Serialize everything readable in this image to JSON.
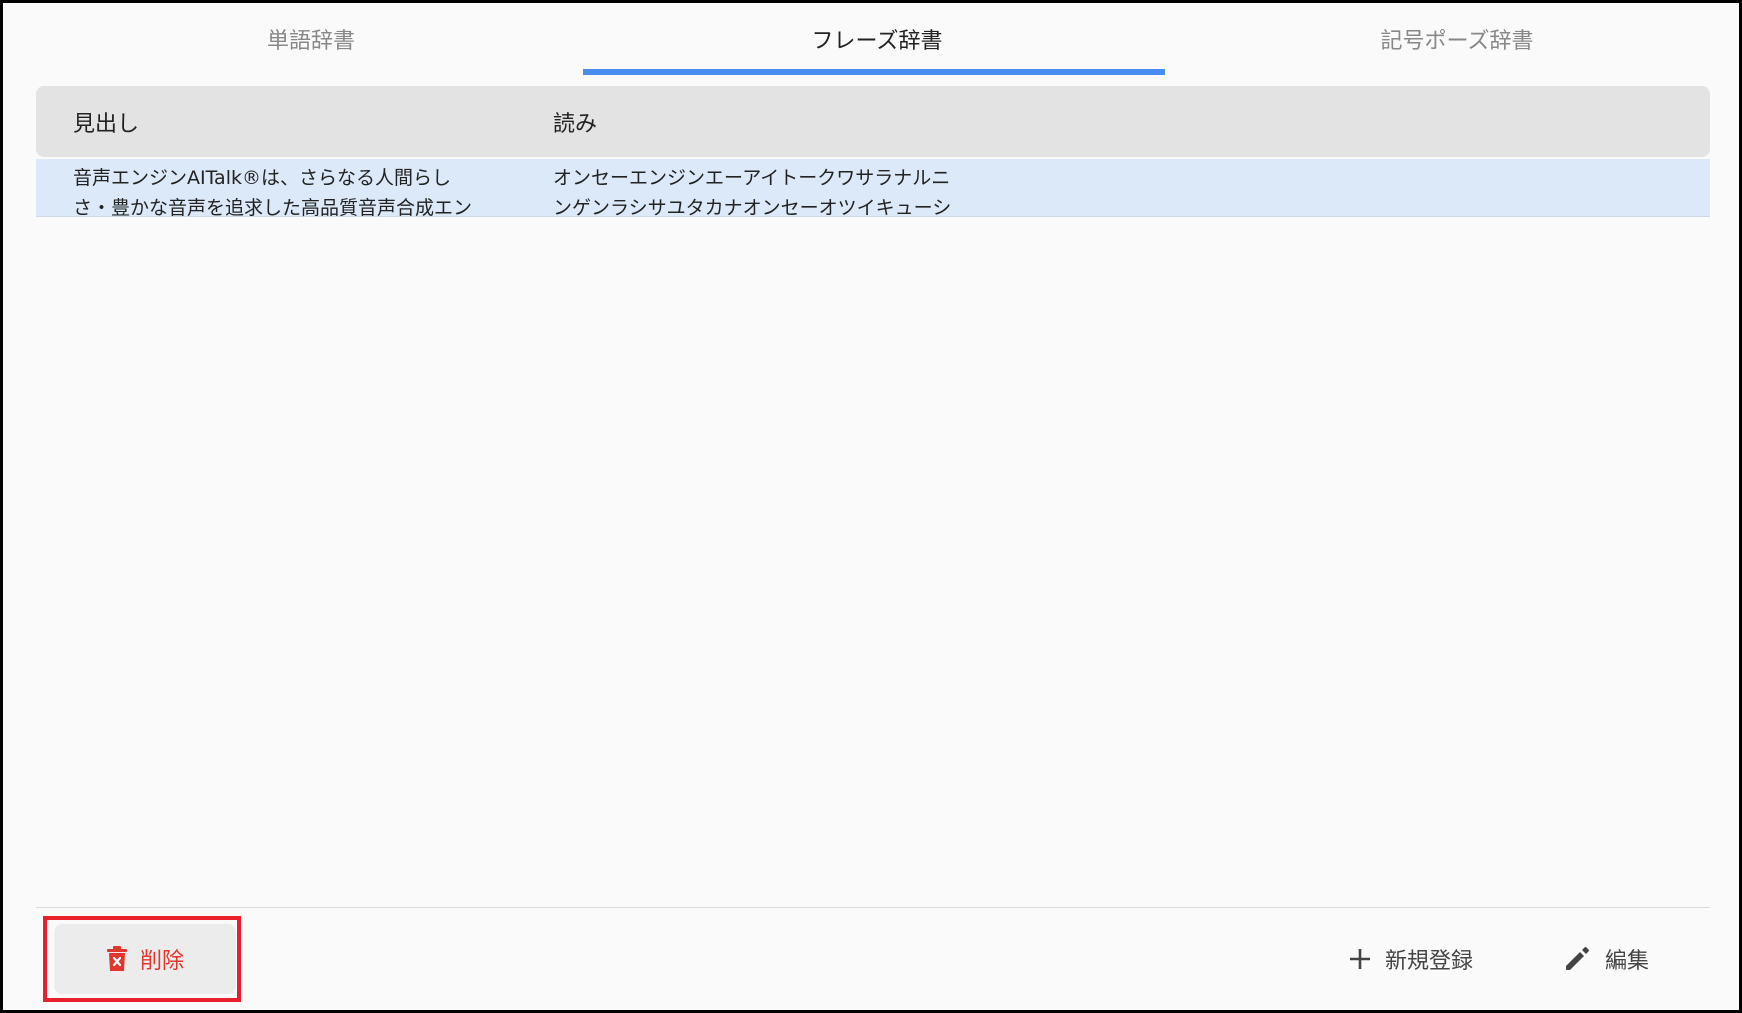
{
  "tabs": [
    {
      "label": "単語辞書",
      "active": false
    },
    {
      "label": "フレーズ辞書",
      "active": true
    },
    {
      "label": "記号ポーズ辞書",
      "active": false
    }
  ],
  "table": {
    "columns": [
      "見出し",
      "読み"
    ],
    "rows": [
      {
        "heading_line1": "音声エンジンAITalk®は、さらなる人間らし",
        "heading_line2": "さ・豊かな音声を追求した高品質音声合成エン",
        "reading_line1": "オンセーエンジンエーアイトークワサラナルニ",
        "reading_line2": "ンゲンラシサユタカナオンセーオツイキューシ",
        "selected": true
      }
    ]
  },
  "footer": {
    "delete_label": "削除",
    "add_label": "新規登録",
    "edit_label": "編集"
  },
  "icons": {
    "delete": "trash-icon",
    "add": "plus-icon",
    "edit": "pencil-icon"
  },
  "colors": {
    "accent": "#4a8df0",
    "danger": "#e0362e",
    "selected_row": "#dbe9f9",
    "header_bg": "#e3e3e3",
    "highlight_box": "#e8202a"
  }
}
